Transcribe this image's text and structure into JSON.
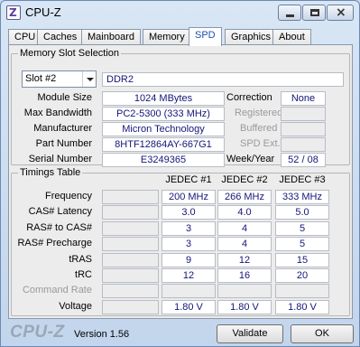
{
  "window": {
    "title": "CPU-Z"
  },
  "tabs": [
    "CPU",
    "Caches",
    "Mainboard",
    "Memory",
    "SPD",
    "Graphics",
    "About"
  ],
  "active_tab": "SPD",
  "slot_section": {
    "label": "Memory Slot Selection",
    "slot_selected": "Slot #2",
    "type": "DDR2",
    "module_size_label": "Module Size",
    "module_size": "1024 MBytes",
    "max_bandwidth_label": "Max Bandwidth",
    "max_bandwidth": "PC2-5300 (333 MHz)",
    "manufacturer_label": "Manufacturer",
    "manufacturer": "Micron Technology",
    "part_number_label": "Part Number",
    "part_number": "8HTF12864AY-667G1",
    "serial_number_label": "Serial Number",
    "serial_number": "E3249365",
    "correction_label": "Correction",
    "correction": "None",
    "registered_label": "Registered",
    "registered": "",
    "buffered_label": "Buffered",
    "buffered": "",
    "spd_ext_label": "SPD Ext.",
    "spd_ext": "",
    "week_year_label": "Week/Year",
    "week_year": "52 / 08"
  },
  "timings": {
    "label": "Timings Table",
    "columns": [
      "JEDEC #1",
      "JEDEC #2",
      "JEDEC #3"
    ],
    "rows": [
      {
        "label": "Frequency",
        "values": [
          "200 MHz",
          "266 MHz",
          "333 MHz"
        ],
        "dim": false
      },
      {
        "label": "CAS# Latency",
        "values": [
          "3.0",
          "4.0",
          "5.0"
        ],
        "dim": false
      },
      {
        "label": "RAS# to CAS#",
        "values": [
          "3",
          "4",
          "5"
        ],
        "dim": false
      },
      {
        "label": "RAS# Precharge",
        "values": [
          "3",
          "4",
          "5"
        ],
        "dim": false
      },
      {
        "label": "tRAS",
        "values": [
          "9",
          "12",
          "15"
        ],
        "dim": false
      },
      {
        "label": "tRC",
        "values": [
          "12",
          "16",
          "20"
        ],
        "dim": false
      },
      {
        "label": "Command Rate",
        "values": [
          "",
          "",
          ""
        ],
        "dim": true
      },
      {
        "label": "Voltage",
        "values": [
          "1.80 V",
          "1.80 V",
          "1.80 V"
        ],
        "dim": false
      }
    ]
  },
  "footer": {
    "brand": "CPU-Z",
    "version": "Version 1.56",
    "validate_label": "Validate",
    "ok_label": "OK"
  }
}
